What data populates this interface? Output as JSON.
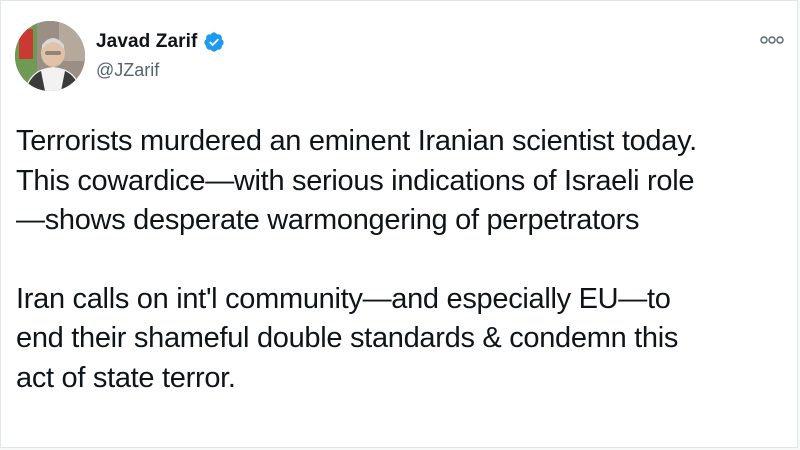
{
  "author": {
    "display_name": "Javad Zarif",
    "handle": "@JZarif",
    "verified": true,
    "avatar_icon": "profile-photo"
  },
  "actions": {
    "more_icon": "more-options-icon"
  },
  "tweet": {
    "paragraphs": [
      {
        "lines": [
          "Terrorists murdered an eminent Iranian scientist today.",
          "This cowardice—with serious indications of Israeli role",
          "—shows desperate warmongering of perpetrators"
        ]
      },
      {
        "lines": [
          "Iran calls on int'l community—and especially EU—to",
          "end their shameful double standards & condemn this",
          "act of state terror."
        ]
      }
    ]
  },
  "colors": {
    "text_primary": "#0f1419",
    "text_secondary": "#536471",
    "verified_blue": "#1d9bf0",
    "border": "#e1e8ed"
  }
}
